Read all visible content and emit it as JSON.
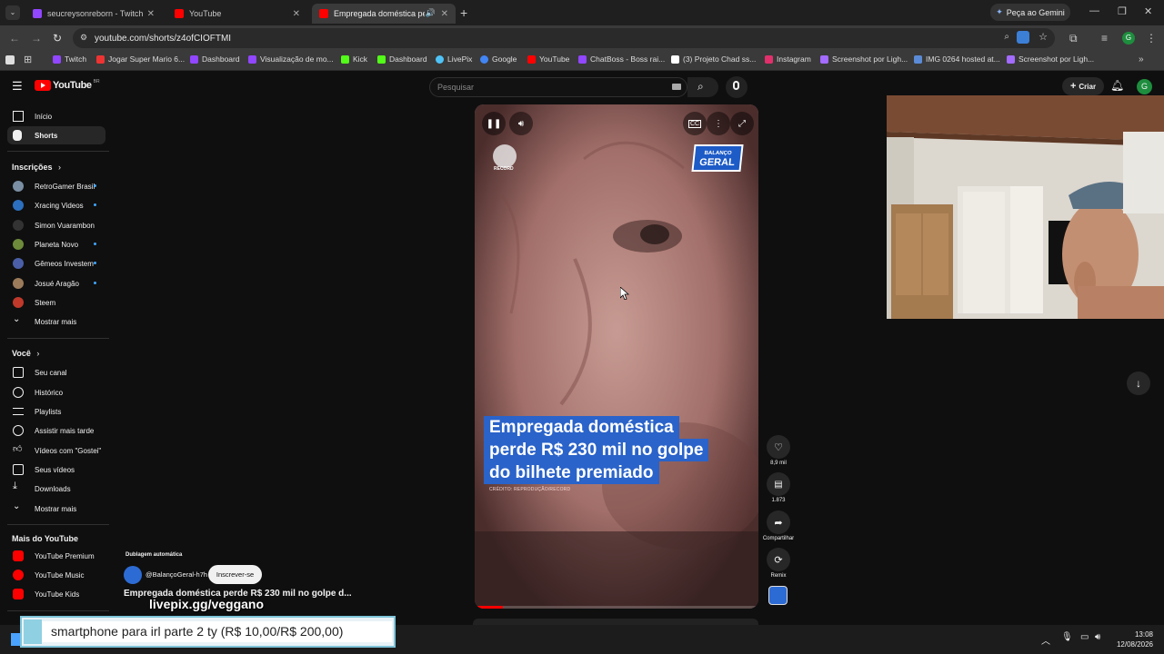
{
  "browser": {
    "tabs": [
      {
        "title": "seucreysonreborn - Twitch",
        "color": "#9146ff"
      },
      {
        "title": "YouTube",
        "color": "#ff0000"
      },
      {
        "title": "Empregada doméstica perd",
        "color": "#ff0000"
      }
    ],
    "gemini_label": "Peça ao Gemini",
    "url": "youtube.com/shorts/z4ofCIOFTMI",
    "bookmarks": [
      {
        "label": "Twitch",
        "color": "#9146ff"
      },
      {
        "label": "Jogar Super Mario 6...",
        "color": "#e33"
      },
      {
        "label": "Dashboard",
        "color": "#9146ff"
      },
      {
        "label": "Visualização de mo...",
        "color": "#9146ff"
      },
      {
        "label": "Kick",
        "color": "#53fc18"
      },
      {
        "label": "Dashboard",
        "color": "#53fc18"
      },
      {
        "label": "LivePix",
        "color": "#4fc3f7"
      },
      {
        "label": "Google",
        "color": "#4285f4"
      },
      {
        "label": "YouTube",
        "color": "#ff0000"
      },
      {
        "label": "ChatBoss - Boss rai...",
        "color": "#9146ff"
      },
      {
        "label": "(3) Projeto Chad ss...",
        "color": "#ffffff"
      },
      {
        "label": "Instagram",
        "color": "#e1306c"
      },
      {
        "label": "Screenshot por Ligh...",
        "color": "#a36bff"
      },
      {
        "label": "IMG 0264 hosted at...",
        "color": "#5b8bd6"
      },
      {
        "label": "Screenshot por Ligh...",
        "color": "#a36bff"
      }
    ]
  },
  "youtube": {
    "logo_text": "YouTube",
    "logo_sup": "BR",
    "search_placeholder": "Pesquisar",
    "create_label": "Criar",
    "avatar_letter": "G"
  },
  "sidebar": {
    "top": [
      {
        "label": "Início",
        "icon": "home-icon"
      },
      {
        "label": "Shorts",
        "icon": "shorts-icon"
      }
    ],
    "subs_header": "Inscrições",
    "subs": [
      {
        "label": "RetroGamer Brasil",
        "color": "#7a8fa3",
        "dot": true
      },
      {
        "label": "Xracing Videos",
        "color": "#2c6fbf",
        "dot": true
      },
      {
        "label": "Simon Vuarambon",
        "color": "#333",
        "dot": false
      },
      {
        "label": "Planeta Novo",
        "color": "#6d8b3a",
        "dot": true
      },
      {
        "label": "Gêmeos Investem",
        "color": "#4a5fa8",
        "dot": true
      },
      {
        "label": "Josué Aragão",
        "color": "#9b7b5a",
        "dot": true
      },
      {
        "label": "Steem",
        "color": "#c0392b",
        "dot": false
      }
    ],
    "subs_more": "Mostrar mais",
    "you_header": "Você",
    "you": [
      {
        "label": "Seu canal",
        "icon": "channel-icon"
      },
      {
        "label": "Histórico",
        "icon": "history-icon"
      },
      {
        "label": "Playlists",
        "icon": "playlists-icon"
      },
      {
        "label": "Assistir mais tarde",
        "icon": "watch-later-icon"
      },
      {
        "label": "Vídeos com \"Gostei\"",
        "icon": "like-icon"
      },
      {
        "label": "Seus vídeos",
        "icon": "your-videos-icon"
      },
      {
        "label": "Downloads",
        "icon": "download-icon"
      }
    ],
    "you_more": "Mostrar mais",
    "more_header": "Mais do YouTube",
    "more": [
      {
        "label": "YouTube Premium",
        "color": "#ff0000"
      },
      {
        "label": "YouTube Music",
        "color": "#ff0000"
      },
      {
        "label": "YouTube Kids",
        "color": "#ff0000"
      }
    ]
  },
  "video": {
    "caption_lines": [
      "Empregada doméstica",
      "perde R$ 230 mil no golpe",
      "do bilhete premiado"
    ],
    "credit": "CRÉDITO: REPRODUÇÃO/RECORD",
    "record_label": "RECORD",
    "balanco_line1": "BALANÇO",
    "balanco_line2": "GERAL",
    "progress": 0.1,
    "caption_color": "#2a63c9"
  },
  "actions": {
    "likes": "8,9 mil",
    "comments": "1.873",
    "share": "Compartilhar",
    "remix": "Remix"
  },
  "channel": {
    "dubbing": "Dublagem automática",
    "handle": "@BalançoGeral-h7h",
    "subscribe": "Inscrever-se",
    "title": "Empregada doméstica perde R$ 230 mil no golpe d..."
  },
  "overlay": {
    "livepix": "livepix.gg/veggano",
    "goal": "smartphone para irl parte 2 ty (R$ 10,00/R$ 200,00)"
  },
  "taskbar": {
    "time": "13:08",
    "date": "12/08/2026"
  }
}
